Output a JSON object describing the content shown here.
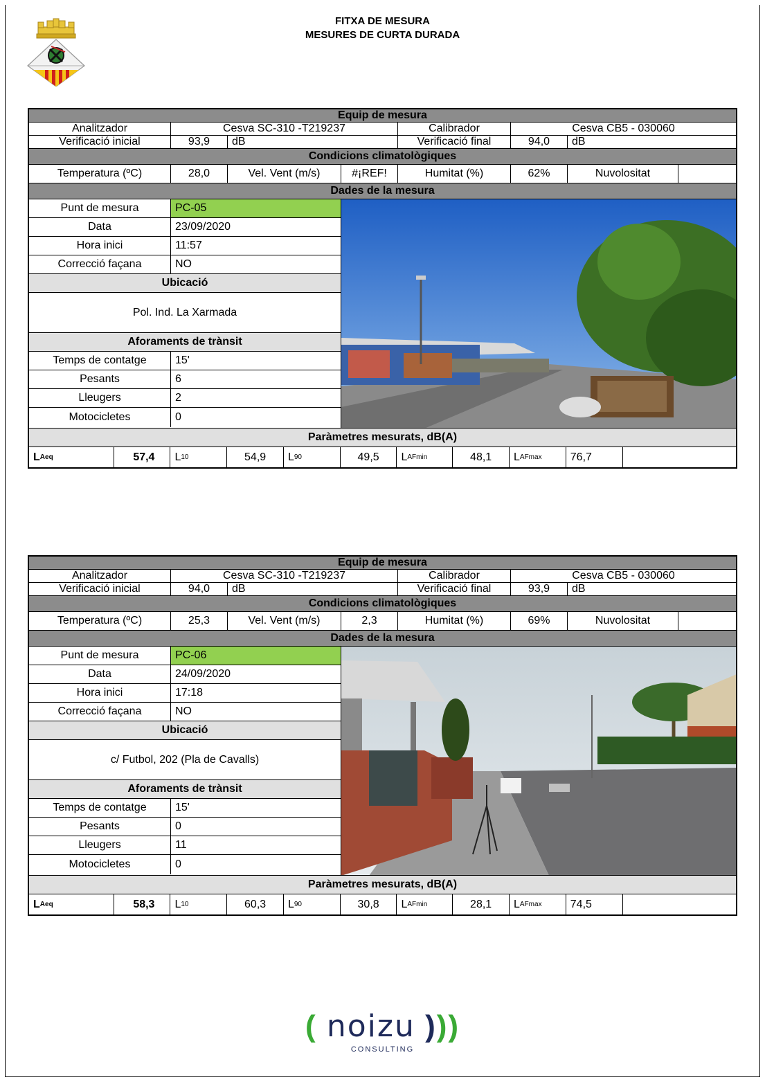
{
  "header": {
    "title_line1": "FITXA DE MESURA",
    "title_line2": "MESURES DE CURTA DURADA"
  },
  "colors": {
    "section_bar": "#8c8c8c",
    "highlight": "#92d050",
    "param_bar": "#e0e0e0",
    "logo_green": "#3aaa35"
  },
  "sheets": [
    {
      "equip_title": "Equip de mesura",
      "analitzador_label": "Analitzador",
      "analitzador_value": "Cesva SC-310 -T219237",
      "calibrador_label": "Calibrador",
      "calibrador_value": "Cesva CB5 - 030060",
      "verif_inicial_label": "Verificació inicial",
      "verif_inicial_value": "93,9",
      "verif_inicial_unit": "dB",
      "verif_final_label": "Verificació final",
      "verif_final_value": "94,0",
      "verif_final_unit": "dB",
      "clima_title": "Condicions climatològiques",
      "temp_label": "Temperatura (ºC)",
      "temp_value": "28,0",
      "vent_label": "Vel. Vent (m/s)",
      "vent_value": "#¡REF!",
      "humitat_label": "Humitat (%)",
      "humitat_value": "62%",
      "nuvol_label": "Nuvolositat",
      "nuvol_value": "",
      "dades_title": "Dades de la mesura",
      "punt_label": "Punt de mesura",
      "punt_value": "PC-05",
      "data_label": "Data",
      "data_value": "23/09/2020",
      "hora_label": "Hora inici",
      "hora_value": "11:57",
      "correccio_label": "Correcció façana",
      "correccio_value": "NO",
      "ubicacio_title": "Ubicació",
      "ubicacio_value": "Pol. Ind. La Xarmada",
      "aforaments_title": "Aforaments de trànsit",
      "temps_label": "Temps de contatge",
      "temps_value": "15'",
      "pesants_label": "Pesants",
      "pesants_value": "6",
      "lleugers_label": "Lleugers",
      "lleugers_value": "2",
      "moto_label": "Motocicletes",
      "moto_value": "0",
      "params_title": "Paràmetres mesurats, dB(A)",
      "laeq_value": "57,4",
      "l10_value": "54,9",
      "l90_value": "49,5",
      "lafmin_value": "48,1",
      "lafmax_value": "76,7"
    },
    {
      "equip_title": "Equip de mesura",
      "analitzador_label": "Analitzador",
      "analitzador_value": "Cesva SC-310 -T219237",
      "calibrador_label": "Calibrador",
      "calibrador_value": "Cesva CB5 - 030060",
      "verif_inicial_label": "Verificació inicial",
      "verif_inicial_value": "94,0",
      "verif_inicial_unit": "dB",
      "verif_final_label": "Verificació final",
      "verif_final_value": "93,9",
      "verif_final_unit": "dB",
      "clima_title": "Condicions climatològiques",
      "temp_label": "Temperatura (ºC)",
      "temp_value": "25,3",
      "vent_label": "Vel. Vent (m/s)",
      "vent_value": "2,3",
      "humitat_label": "Humitat (%)",
      "humitat_value": "69%",
      "nuvol_label": "Nuvolositat",
      "nuvol_value": "",
      "dades_title": "Dades de la mesura",
      "punt_label": "Punt de mesura",
      "punt_value": "PC-06",
      "data_label": "Data",
      "data_value": "24/09/2020",
      "hora_label": "Hora inici",
      "hora_value": "17:18",
      "correccio_label": "Correcció façana",
      "correccio_value": "NO",
      "ubicacio_title": "Ubicació",
      "ubicacio_value": "c/ Futbol, 202 (Pla de Cavalls)",
      "aforaments_title": "Aforaments de trànsit",
      "temps_label": "Temps de contatge",
      "temps_value": "15'",
      "pesants_label": "Pesants",
      "pesants_value": "0",
      "lleugers_label": "Lleugers",
      "lleugers_value": "11",
      "moto_label": "Motocicletes",
      "moto_value": "0",
      "params_title": "Paràmetres mesurats, dB(A)",
      "laeq_value": "58,3",
      "l10_value": "60,3",
      "l90_value": "30,8",
      "lafmin_value": "28,1",
      "lafmax_value": "74,5"
    }
  ],
  "params_labels": {
    "laeq_main": "L",
    "laeq_sub": "Aeq",
    "l10_main": "L",
    "l10_sub": "10",
    "l90_main": "L",
    "l90_sub": "90",
    "lafmin_main": "L",
    "lafmin_sub": "AFmin",
    "lafmax_main": "L",
    "lafmax_sub": "AFmax"
  },
  "footer": {
    "logo_open": "(",
    "logo_word": "noizu",
    "logo_close": ")",
    "logo_sub": "CONSULTING"
  }
}
